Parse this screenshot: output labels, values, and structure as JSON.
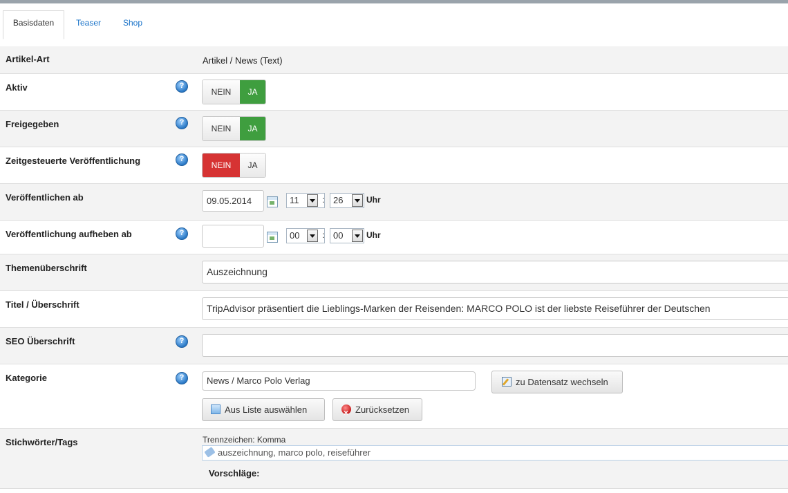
{
  "tabs": [
    "Basisdaten",
    "Teaser",
    "Shop"
  ],
  "rows": {
    "artikel_art": {
      "label": "Artikel-Art",
      "value": "Artikel / News (Text)"
    },
    "aktiv": {
      "label": "Aktiv",
      "no": "NEIN",
      "yes": "JA",
      "selected": "JA"
    },
    "freigegeben": {
      "label": "Freigegeben",
      "no": "NEIN",
      "yes": "JA",
      "selected": "JA"
    },
    "zeitgesteuert": {
      "label": "Zeitgesteuerte Veröffentlichung",
      "no": "NEIN",
      "yes": "JA",
      "selected": "NEIN"
    },
    "veroeffentlichen_ab": {
      "label": "Veröffentlichen ab",
      "date": "09.05.2014",
      "hour": "11",
      "minute": "26",
      "unit": "Uhr"
    },
    "aufheben_ab": {
      "label": "Veröffentlichung aufheben ab",
      "date": "",
      "hour": "00",
      "minute": "00",
      "unit": "Uhr"
    },
    "themen": {
      "label": "Themenüberschrift",
      "value": "Auszeichnung"
    },
    "titel": {
      "label": "Titel / Überschrift",
      "value": "TripAdvisor präsentiert die Lieblings-Marken der Reisenden: MARCO POLO ist der liebste Reiseführer der Deutschen"
    },
    "seo": {
      "label": "SEO Überschrift",
      "value": ""
    },
    "kategorie": {
      "label": "Kategorie",
      "value": "News / Marco Polo Verlag",
      "switch_button": "zu Datensatz wechseln",
      "select_button": "Aus Liste auswählen",
      "reset_button": "Zurücksetzen"
    },
    "tags": {
      "label": "Stichwörter/Tags",
      "separator": "Trennzeichen: Komma",
      "value": "auszeichnung, marco polo, reiseführer",
      "suggestions_label": "Vorschläge:"
    }
  },
  "colors": {
    "yes_on": "#3f9e3f",
    "no_on": "#d63333",
    "link": "#1a73c9"
  },
  "icons": [
    "help-icon",
    "calendar-icon",
    "edit-icon",
    "list-icon",
    "reset-icon",
    "tag-icon"
  ]
}
